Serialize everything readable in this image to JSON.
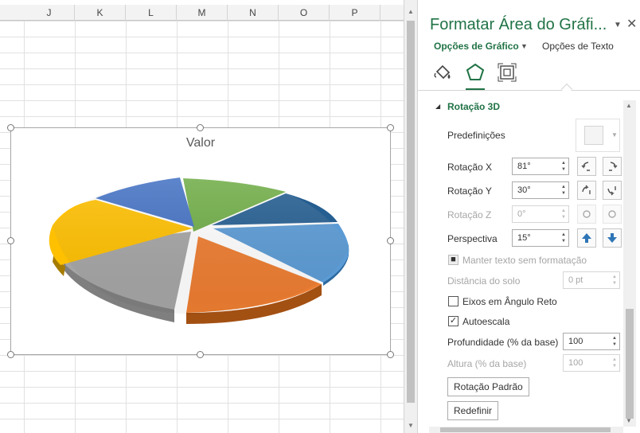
{
  "spreadsheet": {
    "columns": [
      "J",
      "K",
      "L",
      "M",
      "N",
      "O",
      "P"
    ]
  },
  "chart": {
    "title": "Valor",
    "slices": [
      {
        "color": "#70AD47"
      },
      {
        "color": "#255E91"
      },
      {
        "color": "#5B9BD5"
      },
      {
        "color": "#ED7D31"
      },
      {
        "color": "#A5A5A5"
      },
      {
        "color": "#FFC000"
      },
      {
        "color": "#4472C4"
      }
    ]
  },
  "pane": {
    "title": "Formatar Área do Gráfi...",
    "tabs": {
      "chart_options": "Opções de Gráfico",
      "text_options": "Opções de Texto"
    },
    "icons": [
      "fill-bucket-icon",
      "pentagon-effects-icon",
      "size-properties-icon"
    ],
    "section": {
      "title": "Rotação 3D",
      "presets_label": "Predefinições",
      "x_label": "Rotação X",
      "x_value": "81°",
      "y_label": "Rotação Y",
      "y_value": "30°",
      "z_label": "Rotação Z",
      "z_value": "0°",
      "perspective_label": "Perspectiva",
      "perspective_value": "15°",
      "keep_text_flat_label": "Manter texto sem formatação",
      "keep_text_flat_checked": true,
      "distance_label": "Distância do solo",
      "distance_value": "0 pt",
      "right_angle_axes_label": "Eixos em Ângulo Reto",
      "right_angle_axes_checked": false,
      "autoscale_label": "Autoescala",
      "autoscale_checked": true,
      "depth_label": "Profundidade (% da base)",
      "depth_value": "100",
      "height_label": "Altura (% da base)",
      "height_value": "100",
      "default_rotation_button": "Rotação Padrão",
      "reset_button": "Redefinir"
    }
  },
  "colors": {
    "accent": "#217346",
    "arrow_button": "#2E75B6"
  }
}
